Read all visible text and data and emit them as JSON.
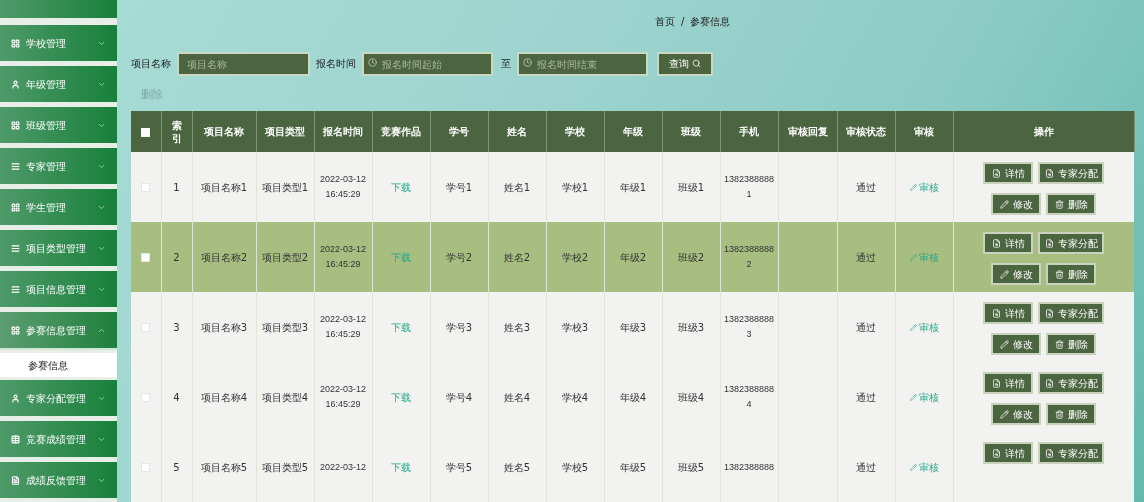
{
  "sidebar": {
    "items": [
      {
        "label": "学校管理",
        "expanded": false
      },
      {
        "label": "年级管理",
        "expanded": false
      },
      {
        "label": "班级管理",
        "expanded": false
      },
      {
        "label": "专家管理",
        "expanded": false
      },
      {
        "label": "学生管理",
        "expanded": false
      },
      {
        "label": "项目类型管理",
        "expanded": false
      },
      {
        "label": "项目信息管理",
        "expanded": false
      },
      {
        "label": "参赛信息管理",
        "expanded": true,
        "children": [
          {
            "label": "参赛信息",
            "selected": true
          }
        ]
      },
      {
        "label": "专家分配管理",
        "expanded": false
      },
      {
        "label": "竞赛成绩管理",
        "expanded": false
      },
      {
        "label": "成绩反馈管理",
        "expanded": false
      }
    ]
  },
  "breadcrumb": [
    "首页",
    "/",
    "参赛信息"
  ],
  "search": {
    "fields": [
      {
        "label": "项目名称",
        "placeholder": "项目名称",
        "kind": "text"
      },
      {
        "label": "报名时间",
        "placeholder": "报名时间起始",
        "kind": "date"
      },
      {
        "label": "至",
        "placeholder": "报名时间结束",
        "kind": "date"
      }
    ],
    "button": "查询"
  },
  "delete_button": {
    "label": "删除",
    "disabled": true
  },
  "table": {
    "columns": [
      "索引",
      "项目名称",
      "项目类型",
      "报名时间",
      "竞赛作品",
      "学号",
      "姓名",
      "学校",
      "年级",
      "班级",
      "手机",
      "审核回复",
      "审核状态",
      "审核",
      "操作"
    ],
    "header_checked": false,
    "rows": [
      {
        "checked": false,
        "selected": false,
        "index": "1",
        "name": "项目名称1",
        "type": "项目类型1",
        "time": "2022-03-12 16:45:29",
        "work": "下载",
        "student_no": "学号1",
        "student_name": "姓名1",
        "school": "学校1",
        "grade": "年级1",
        "class": "班级1",
        "phone": "13823888881",
        "status": "通过",
        "review": "审核",
        "actions": [
          "详情",
          "专家分配",
          "修改",
          "删除"
        ]
      },
      {
        "checked": false,
        "selected": true,
        "index": "2",
        "name": "项目名称2",
        "type": "项目类型2",
        "time": "2022-03-12 16:45:29",
        "work": "下载",
        "student_no": "学号2",
        "student_name": "姓名2",
        "school": "学校2",
        "grade": "年级2",
        "class": "班级2",
        "phone": "13823888882",
        "status": "通过",
        "review": "审核",
        "actions": [
          "详情",
          "专家分配",
          "修改",
          "删除"
        ]
      },
      {
        "checked": false,
        "selected": false,
        "index": "3",
        "name": "项目名称3",
        "type": "项目类型3",
        "time": "2022-03-12 16:45:29",
        "work": "下载",
        "student_no": "学号3",
        "student_name": "姓名3",
        "school": "学校3",
        "grade": "年级3",
        "class": "班级3",
        "phone": "13823888883",
        "status": "通过",
        "review": "审核",
        "actions": [
          "详情",
          "专家分配",
          "修改",
          "删除"
        ]
      },
      {
        "checked": false,
        "selected": false,
        "index": "4",
        "name": "项目名称4",
        "type": "项目类型4",
        "time": "2022-03-12 16:45:29",
        "work": "下载",
        "student_no": "学号4",
        "student_name": "姓名4",
        "school": "学校4",
        "grade": "年级4",
        "class": "班级4",
        "phone": "13823888884",
        "status": "通过",
        "review": "审核",
        "actions": [
          "详情",
          "专家分配",
          "修改",
          "删除"
        ]
      },
      {
        "checked": false,
        "selected": false,
        "index": "5",
        "name": "项目名称5",
        "type": "项目类型5",
        "time": "2022-03-12",
        "work": "下载",
        "student_no": "学号5",
        "student_name": "姓名5",
        "school": "学校5",
        "grade": "年级5",
        "class": "班级5",
        "phone": "1382388888",
        "status": "通过",
        "review": "审核",
        "actions": [
          "详情",
          "专家分配"
        ]
      }
    ]
  }
}
